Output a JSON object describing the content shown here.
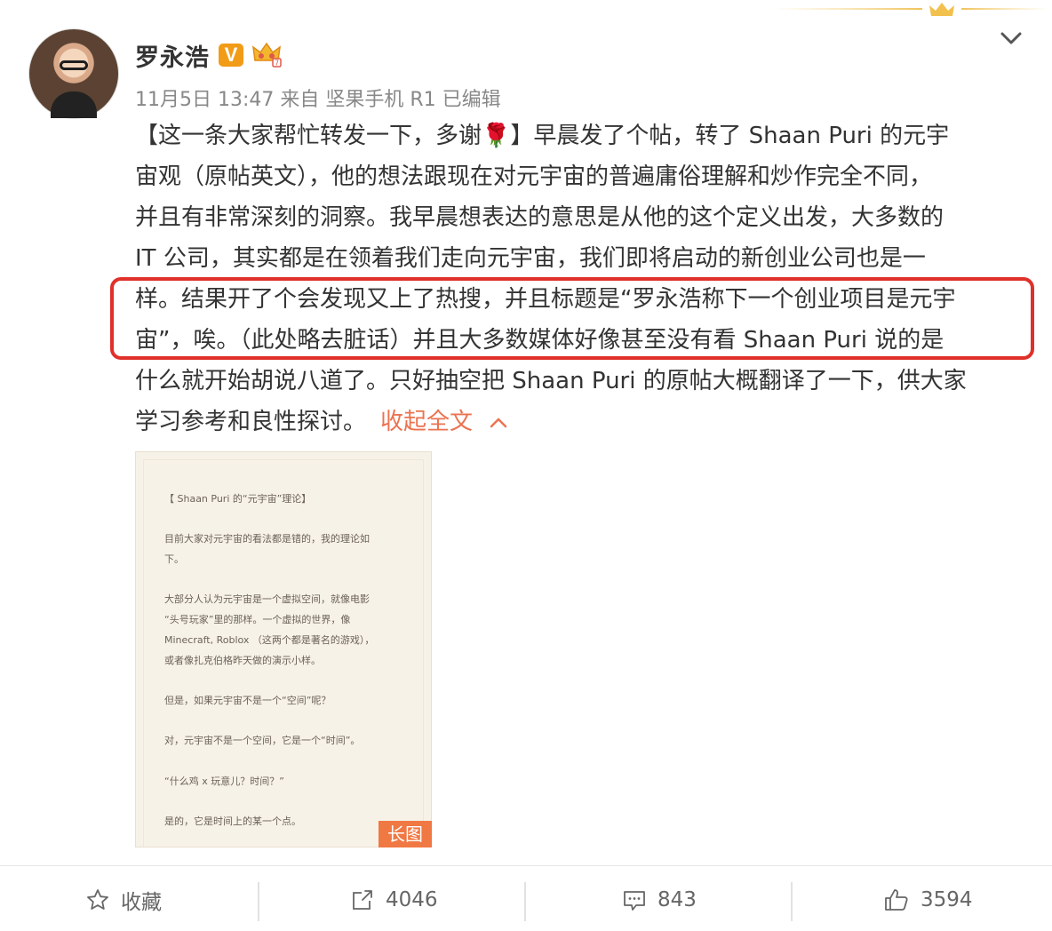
{
  "author": {
    "name": "罗永浩",
    "verified_badge": "V",
    "avatar_icon": "avatar-photo"
  },
  "meta": {
    "text": "11月5日 13:47 来自 坚果手机 R1   已编辑"
  },
  "post": {
    "lines": [
      "【这一条大家帮忙转发一下，多谢🌹】早晨发了个帖，转了 Shaan Puri 的元宇",
      "宙观（原帖英文），他的想法跟现在对元宇宙的普遍庸俗理解和炒作完全不同，",
      "并且有非常深刻的洞察。我早晨想表达的意思是从他的这个定义出发，大多数的",
      "IT 公司，其实都是在领着我们走向元宇宙，我们即将启动的新创业公司也是一",
      "样。结果开了个会发现又上了热搜，并且标题是“罗永浩称下一个创业项目是元宇",
      "宙”，唉。（此处略去脏话）并且大多数媒体好像甚至没有看 Shaan Puri 说的是",
      "什么就开始胡说八道了。只好抽空把 Shaan Puri 的原帖大概翻译了一下，供大家"
    ],
    "last_line": "学习参考和良性探讨。",
    "collapse_label": "收起全文"
  },
  "image": {
    "badge": "长图",
    "lines": [
      "【 Shaan Puri 的“元宇宙”理论】",
      "目前大家对元宇宙的看法都是错的，我的理论如",
      "下。",
      "大部分人认为元宇宙是一个虚拟空间，就像电影",
      "“头号玩家”里的那样。一个虚拟的世界，像",
      "Minecraft, Roblox （这两个都是著名的游戏），",
      "或者像扎克伯格昨天做的演示小样。",
      "但是，如果元宇宙不是一个“空间”呢？",
      "对，元宇宙不是一个空间，它是一个“时间”。",
      "“什么鸡 x 玩意儿？时间？”",
      "是的，它是时间上的某一个点。"
    ]
  },
  "actions": {
    "favorite": "收藏",
    "repost": "4046",
    "comment": "843",
    "like": "3594"
  },
  "colors": {
    "accent_link": "#eb7350",
    "highlight_border": "#e0302a",
    "badge_orange": "#f29b16"
  }
}
